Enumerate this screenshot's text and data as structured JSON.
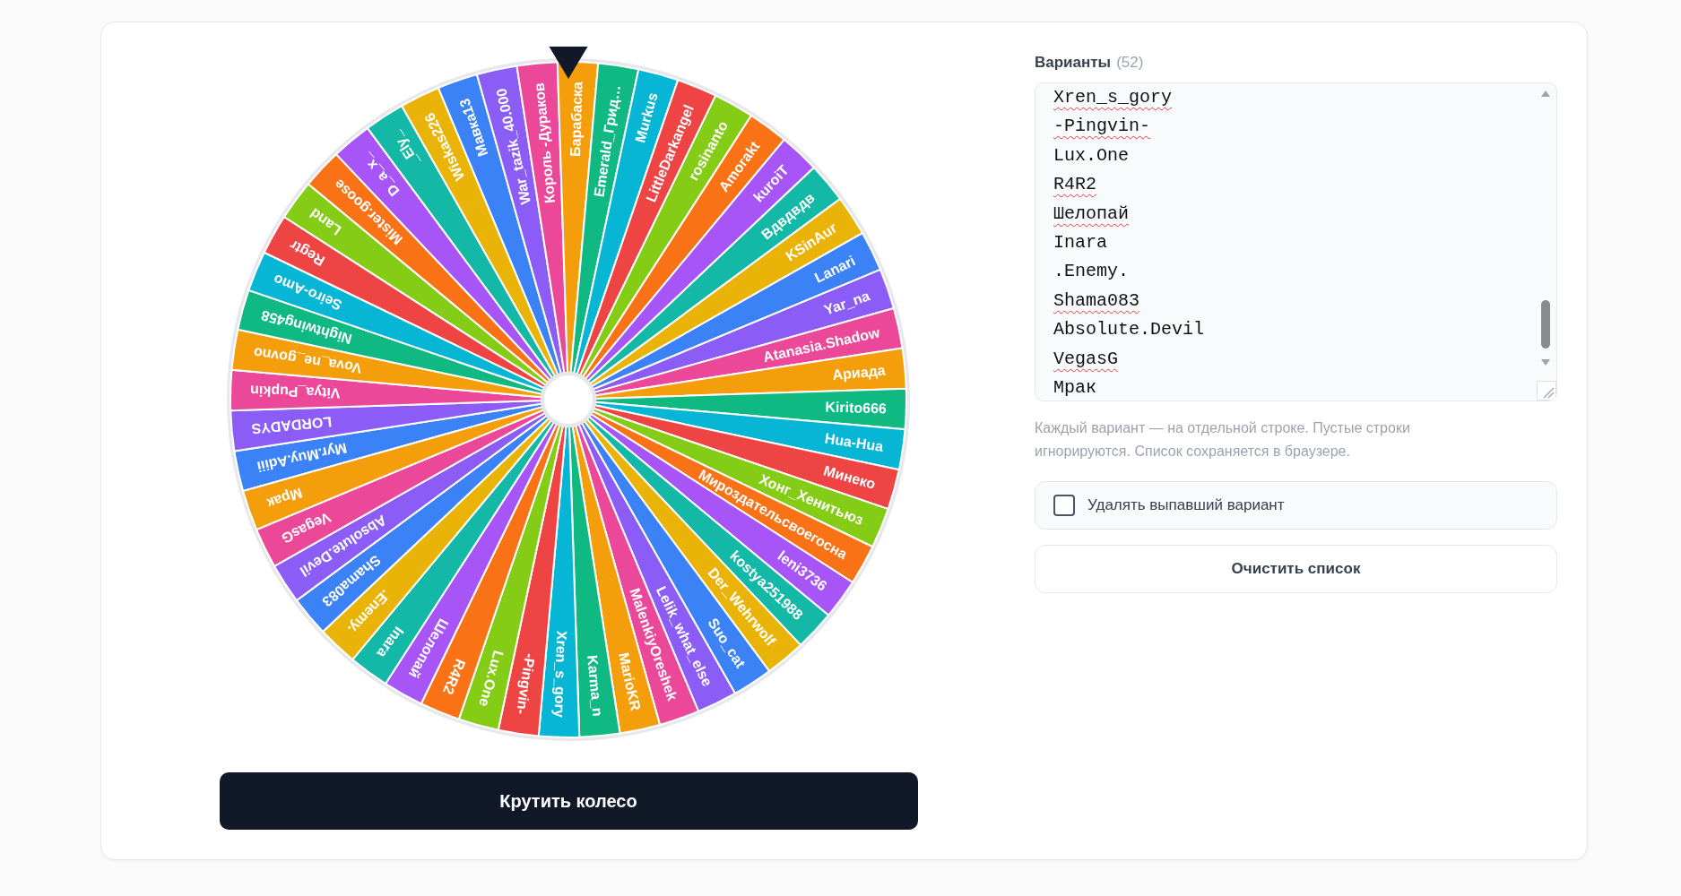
{
  "wheel": {
    "segments": [
      {
        "label": "Myr.Muy.Adiii",
        "selected": false
      },
      {
        "label": "LORDADYS",
        "selected": false
      },
      {
        "label": "Vitya_Pupkin",
        "selected": false
      },
      {
        "label": "Vova_ne_govno",
        "selected": false
      },
      {
        "label": "Nightwing458",
        "selected": false
      },
      {
        "label": "Seiro-Amo",
        "selected": false
      },
      {
        "label": "Regtr",
        "selected": false
      },
      {
        "label": "Land",
        "selected": false
      },
      {
        "label": "Mister.goose",
        "selected": false
      },
      {
        "label": "D_a_x_",
        "selected": false
      },
      {
        "label": "_Ely_",
        "selected": false
      },
      {
        "label": "Wiskas226",
        "selected": false
      },
      {
        "label": "Мавка13",
        "selected": false
      },
      {
        "label": "War_tazik_40.000",
        "selected": false
      },
      {
        "label": "Король -Дураков",
        "selected": false
      },
      {
        "label": "Барабаска",
        "selected": true
      },
      {
        "label": "Emerald_Грид…",
        "selected": false
      },
      {
        "label": "Murkus",
        "selected": false
      },
      {
        "label": "LittleDarkangel",
        "selected": false
      },
      {
        "label": "rosinanto",
        "selected": false
      },
      {
        "label": "Amorakt",
        "selected": false
      },
      {
        "label": "kuroiT",
        "selected": false
      },
      {
        "label": "Вдвдвдв",
        "selected": false
      },
      {
        "label": "KSinAur",
        "selected": false
      },
      {
        "label": "Lanari",
        "selected": false
      },
      {
        "label": "Yar_na",
        "selected": false
      },
      {
        "label": "Atanasia.Shadow",
        "selected": false
      },
      {
        "label": "Ариада",
        "selected": false
      },
      {
        "label": "Kirito666",
        "selected": false
      },
      {
        "label": "Hua-Hua",
        "selected": false
      },
      {
        "label": "Минеко",
        "selected": false
      },
      {
        "label": "Хонг_Хенитьюз",
        "selected": false
      },
      {
        "label": "Мироздательсвоегосна",
        "selected": false
      },
      {
        "label": "leni3736",
        "selected": false
      },
      {
        "label": "kostya251988",
        "selected": false
      },
      {
        "label": "Der_Wehrwolf",
        "selected": false
      },
      {
        "label": "Suo_cat",
        "selected": false
      },
      {
        "label": "Lelik_what_else",
        "selected": false
      },
      {
        "label": "MalenkiyOreshek",
        "selected": false
      },
      {
        "label": "MarioKR",
        "selected": false
      },
      {
        "label": "Karma_n",
        "selected": false
      },
      {
        "label": "Xren_s_gory",
        "selected": false
      },
      {
        "label": "-Pingvin-",
        "selected": false
      },
      {
        "label": "Lux.One",
        "selected": false
      },
      {
        "label": "R4R2",
        "selected": false
      },
      {
        "label": "Шелопай",
        "selected": false
      },
      {
        "label": "Inara",
        "selected": false
      },
      {
        "label": ".Enemy.",
        "selected": false
      },
      {
        "label": "Shama083",
        "selected": false
      },
      {
        "label": "Absolute.Devil",
        "selected": false
      },
      {
        "label": "VegasG",
        "selected": false
      },
      {
        "label": "Мрак",
        "selected": false
      }
    ]
  },
  "spin_button": {
    "label": "Крутить колесо"
  },
  "options": {
    "label": "Варианты",
    "count": "(52)",
    "lines": [
      {
        "text": "Xren_s_gory",
        "spell_error": true
      },
      {
        "text": "-Pingvin-",
        "spell_error": true
      },
      {
        "text": "Lux.One",
        "spell_error": false
      },
      {
        "text": "R4R2",
        "spell_error": true
      },
      {
        "text": "Шелопай",
        "spell_error": true
      },
      {
        "text": "Inara",
        "spell_error": false
      },
      {
        "text": ".Enemy.",
        "spell_error": false
      },
      {
        "text": "Shama083",
        "spell_error": true
      },
      {
        "text": "Absolute.Devil",
        "spell_error": false
      },
      {
        "text": "VegasG",
        "spell_error": true
      },
      {
        "text": "Мрак",
        "spell_error": false
      }
    ],
    "hint": "Каждый вариант — на отдельной строке. Пустые строки игнорируются. Список сохраняется в браузере.",
    "remove_winner": {
      "label": "Удалять выпавший вариант",
      "checked": false
    },
    "clear_button": {
      "label": "Очистить список"
    }
  }
}
